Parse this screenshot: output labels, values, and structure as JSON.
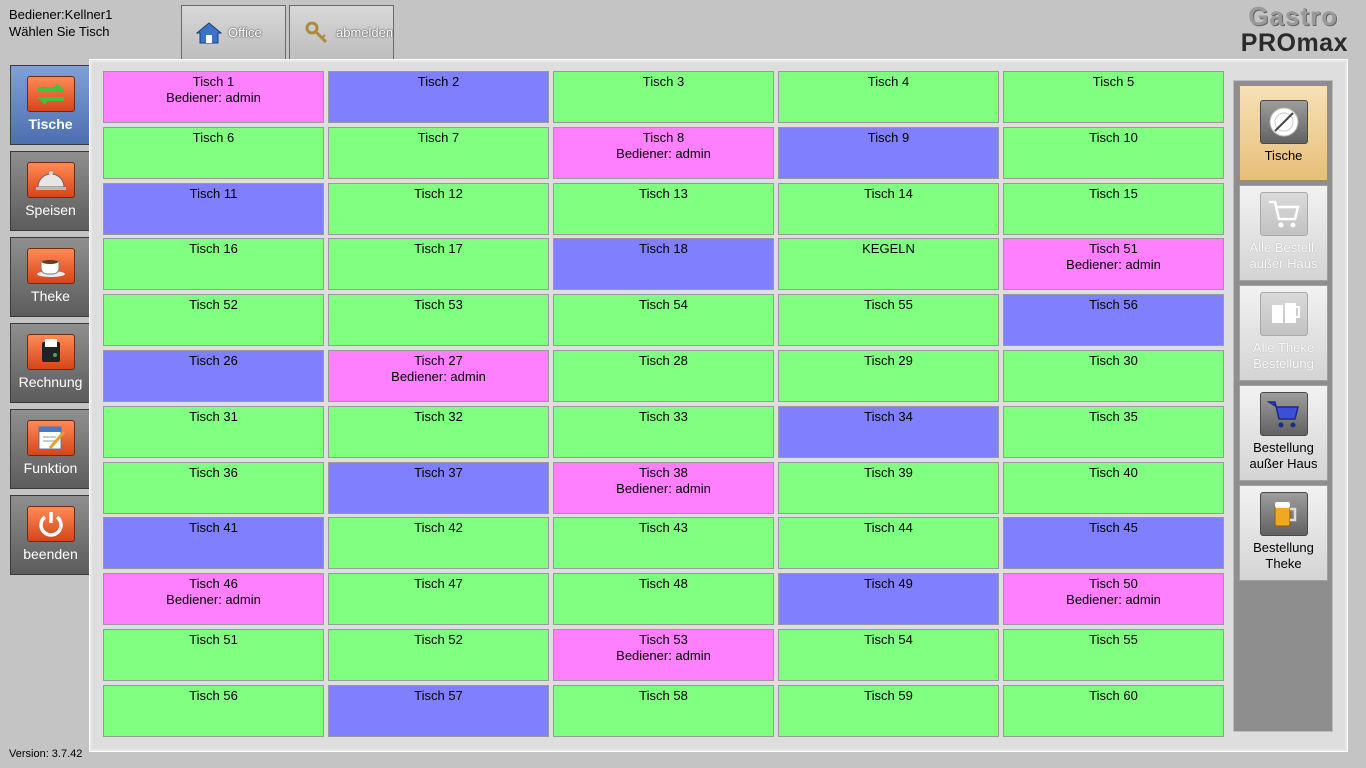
{
  "status": {
    "bediener": "Bediener:Kellner1",
    "prompt": "Wählen Sie Tisch",
    "version": "Version: 3.7.42"
  },
  "top_buttons": {
    "office": "Office",
    "abmelden": "abmelden"
  },
  "logo": {
    "line1": "Gastro",
    "line2": "PROmax"
  },
  "nav": [
    {
      "label": "Tische",
      "icon": "tables-swap-icon",
      "active": true
    },
    {
      "label": "Speisen",
      "icon": "cloche-icon",
      "active": false
    },
    {
      "label": "Theke",
      "icon": "coffee-cup-icon",
      "active": false
    },
    {
      "label": "Rechnung",
      "icon": "receipt-printer-icon",
      "active": false
    },
    {
      "label": "Funktion",
      "icon": "function-edit-icon",
      "active": false
    },
    {
      "label": "beenden",
      "icon": "power-icon",
      "active": false
    }
  ],
  "tables": [
    {
      "name": "Tisch 1",
      "note": "Bediener: admin",
      "state": "occupied"
    },
    {
      "name": "Tisch 2",
      "note": "",
      "state": "reserved"
    },
    {
      "name": "Tisch 3",
      "note": "",
      "state": "free"
    },
    {
      "name": "Tisch 4",
      "note": "",
      "state": "free"
    },
    {
      "name": "Tisch 5",
      "note": "",
      "state": "free"
    },
    {
      "name": "Tisch 6",
      "note": "",
      "state": "free"
    },
    {
      "name": "Tisch 7",
      "note": "",
      "state": "free"
    },
    {
      "name": "Tisch 8",
      "note": "Bediener: admin",
      "state": "occupied"
    },
    {
      "name": "Tisch 9",
      "note": "",
      "state": "reserved"
    },
    {
      "name": "Tisch 10",
      "note": "",
      "state": "free"
    },
    {
      "name": "Tisch 11",
      "note": "",
      "state": "reserved"
    },
    {
      "name": "Tisch 12",
      "note": "",
      "state": "free"
    },
    {
      "name": "Tisch 13",
      "note": "",
      "state": "free"
    },
    {
      "name": "Tisch 14",
      "note": "",
      "state": "free"
    },
    {
      "name": "Tisch 15",
      "note": "",
      "state": "free"
    },
    {
      "name": "Tisch 16",
      "note": "",
      "state": "free"
    },
    {
      "name": "Tisch 17",
      "note": "",
      "state": "free"
    },
    {
      "name": "Tisch 18",
      "note": "",
      "state": "reserved"
    },
    {
      "name": "KEGELN",
      "note": "",
      "state": "free"
    },
    {
      "name": "Tisch 51",
      "note": "Bediener: admin",
      "state": "occupied"
    },
    {
      "name": "Tisch 52",
      "note": "",
      "state": "free"
    },
    {
      "name": "Tisch 53",
      "note": "",
      "state": "free"
    },
    {
      "name": "Tisch 54",
      "note": "",
      "state": "free"
    },
    {
      "name": "Tisch 55",
      "note": "",
      "state": "free"
    },
    {
      "name": "Tisch 56",
      "note": "",
      "state": "reserved"
    },
    {
      "name": "Tisch 26",
      "note": "",
      "state": "reserved"
    },
    {
      "name": "Tisch 27",
      "note": "Bediener: admin",
      "state": "occupied"
    },
    {
      "name": "Tisch 28",
      "note": "",
      "state": "free"
    },
    {
      "name": "Tisch 29",
      "note": "",
      "state": "free"
    },
    {
      "name": "Tisch 30",
      "note": "",
      "state": "free"
    },
    {
      "name": "Tisch 31",
      "note": "",
      "state": "free"
    },
    {
      "name": "Tisch 32",
      "note": "",
      "state": "free"
    },
    {
      "name": "Tisch 33",
      "note": "",
      "state": "free"
    },
    {
      "name": "Tisch 34",
      "note": "",
      "state": "reserved"
    },
    {
      "name": "Tisch 35",
      "note": "",
      "state": "free"
    },
    {
      "name": "Tisch 36",
      "note": "",
      "state": "free"
    },
    {
      "name": "Tisch 37",
      "note": "",
      "state": "reserved"
    },
    {
      "name": "Tisch 38",
      "note": "Bediener: admin",
      "state": "occupied"
    },
    {
      "name": "Tisch 39",
      "note": "",
      "state": "free"
    },
    {
      "name": "Tisch 40",
      "note": "",
      "state": "free"
    },
    {
      "name": "Tisch 41",
      "note": "",
      "state": "reserved"
    },
    {
      "name": "Tisch 42",
      "note": "",
      "state": "free"
    },
    {
      "name": "Tisch 43",
      "note": "",
      "state": "free"
    },
    {
      "name": "Tisch 44",
      "note": "",
      "state": "free"
    },
    {
      "name": "Tisch 45",
      "note": "",
      "state": "reserved"
    },
    {
      "name": "Tisch 46",
      "note": "Bediener: admin",
      "state": "occupied"
    },
    {
      "name": "Tisch 47",
      "note": "",
      "state": "free"
    },
    {
      "name": "Tisch 48",
      "note": "",
      "state": "free"
    },
    {
      "name": "Tisch 49",
      "note": "",
      "state": "reserved"
    },
    {
      "name": "Tisch 50",
      "note": "Bediener: admin",
      "state": "occupied"
    },
    {
      "name": "Tisch 51",
      "note": "",
      "state": "free"
    },
    {
      "name": "Tisch 52",
      "note": "",
      "state": "free"
    },
    {
      "name": "Tisch 53",
      "note": "Bediener: admin",
      "state": "occupied"
    },
    {
      "name": "Tisch 54",
      "note": "",
      "state": "free"
    },
    {
      "name": "Tisch 55",
      "note": "",
      "state": "free"
    },
    {
      "name": "Tisch 56",
      "note": "",
      "state": "free"
    },
    {
      "name": "Tisch 57",
      "note": "",
      "state": "reserved"
    },
    {
      "name": "Tisch 58",
      "note": "",
      "state": "free"
    },
    {
      "name": "Tisch 59",
      "note": "",
      "state": "free"
    },
    {
      "name": "Tisch 60",
      "note": "",
      "state": "free"
    }
  ],
  "right_panel": [
    {
      "line1": "Tische",
      "line2": "",
      "icon": "plate-cutlery-icon",
      "state": "active"
    },
    {
      "line1": "Alle Bestell.",
      "line2": "außer Haus",
      "icon": "cart-icon",
      "state": "disabled"
    },
    {
      "line1": "Alle Theke",
      "line2": "Bestellung",
      "icon": "mugs-icon",
      "state": "disabled"
    },
    {
      "line1": "Bestellung",
      "line2": "außer Haus",
      "icon": "cart-icon",
      "state": "normal"
    },
    {
      "line1": "Bestellung",
      "line2": "Theke",
      "icon": "beer-mug-icon",
      "state": "normal"
    }
  ],
  "colors": {
    "free": "#80ff80",
    "occupied": "#ff80ff",
    "reserved": "#8080ff",
    "nav_active": "#5f80c4",
    "accent_orange": "#e8632c"
  }
}
